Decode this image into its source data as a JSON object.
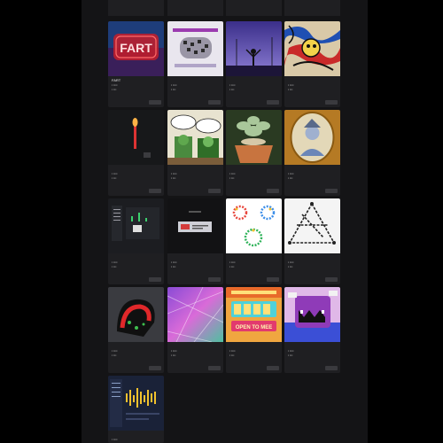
{
  "grid": {
    "cards": [
      {
        "title": "FART",
        "badge": "",
        "owner": "",
        "meta": "",
        "button": ""
      },
      {
        "title": "",
        "badge": "",
        "owner": "",
        "meta": "",
        "button": ""
      },
      {
        "title": "",
        "badge": "",
        "owner": "",
        "meta": "",
        "button": ""
      },
      {
        "title": "",
        "badge": "",
        "owner": "",
        "meta": "",
        "button": ""
      },
      {
        "title": "",
        "badge": "",
        "owner": "",
        "meta": "",
        "button": ""
      },
      {
        "title": "",
        "badge": "",
        "owner": "",
        "meta": "",
        "button": ""
      },
      {
        "title": "",
        "badge": "",
        "owner": "",
        "meta": "",
        "button": ""
      },
      {
        "title": "",
        "badge": "",
        "owner": "",
        "meta": "",
        "button": ""
      },
      {
        "title": "",
        "badge": "",
        "owner": "",
        "meta": "",
        "button": ""
      },
      {
        "title": "",
        "badge": "",
        "owner": "",
        "meta": "",
        "button": ""
      },
      {
        "title": "",
        "badge": "",
        "owner": "",
        "meta": "",
        "button": ""
      },
      {
        "title": "",
        "badge": "",
        "owner": "",
        "meta": "",
        "button": ""
      },
      {
        "title": "",
        "badge": "",
        "owner": "",
        "meta": "",
        "button": ""
      },
      {
        "title": "",
        "badge": "",
        "owner": "",
        "meta": "",
        "button": ""
      },
      {
        "title": "OPEN TO MEE",
        "badge": "",
        "owner": "",
        "meta": "",
        "button": ""
      },
      {
        "title": "",
        "badge": "",
        "owner": "",
        "meta": "",
        "button": ""
      },
      {
        "title": "",
        "badge": "",
        "owner": "",
        "meta": "",
        "button": ""
      }
    ],
    "art_text": {
      "fart": "FART",
      "open_to": "OPEN TO MEE"
    }
  },
  "colors": {
    "page_bg": "#141416",
    "card_bg": "#1f1f22",
    "outer_bg": "#000000"
  }
}
